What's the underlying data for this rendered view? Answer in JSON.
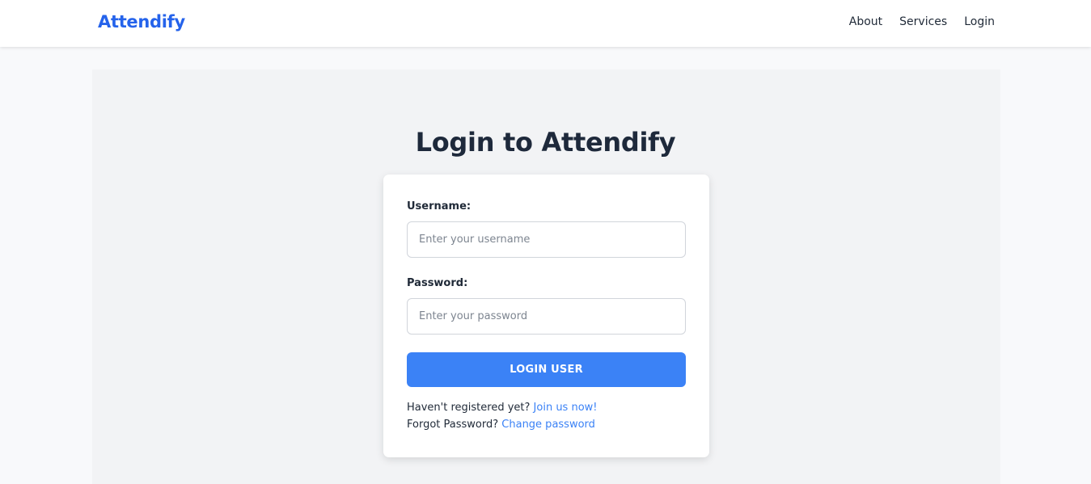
{
  "navbar": {
    "brand": "Attendify",
    "links": [
      "About",
      "Services",
      "Login"
    ]
  },
  "page": {
    "title": "Login to Attendify"
  },
  "form": {
    "username_label": "Username:",
    "username_placeholder": "Enter your username",
    "username_value": "",
    "password_label": "Password:",
    "password_placeholder": "Enter your password",
    "password_value": "",
    "submit_label": "LOGIN USER",
    "register_prompt": "Haven't registered yet?",
    "register_link": "Join us now!",
    "forgot_prompt": "Forgot Password?",
    "forgot_link": "Change password"
  },
  "colors": {
    "brand": "#2563eb",
    "button": "#3b82f6",
    "link": "#3b82f6",
    "title": "#1e293b"
  }
}
